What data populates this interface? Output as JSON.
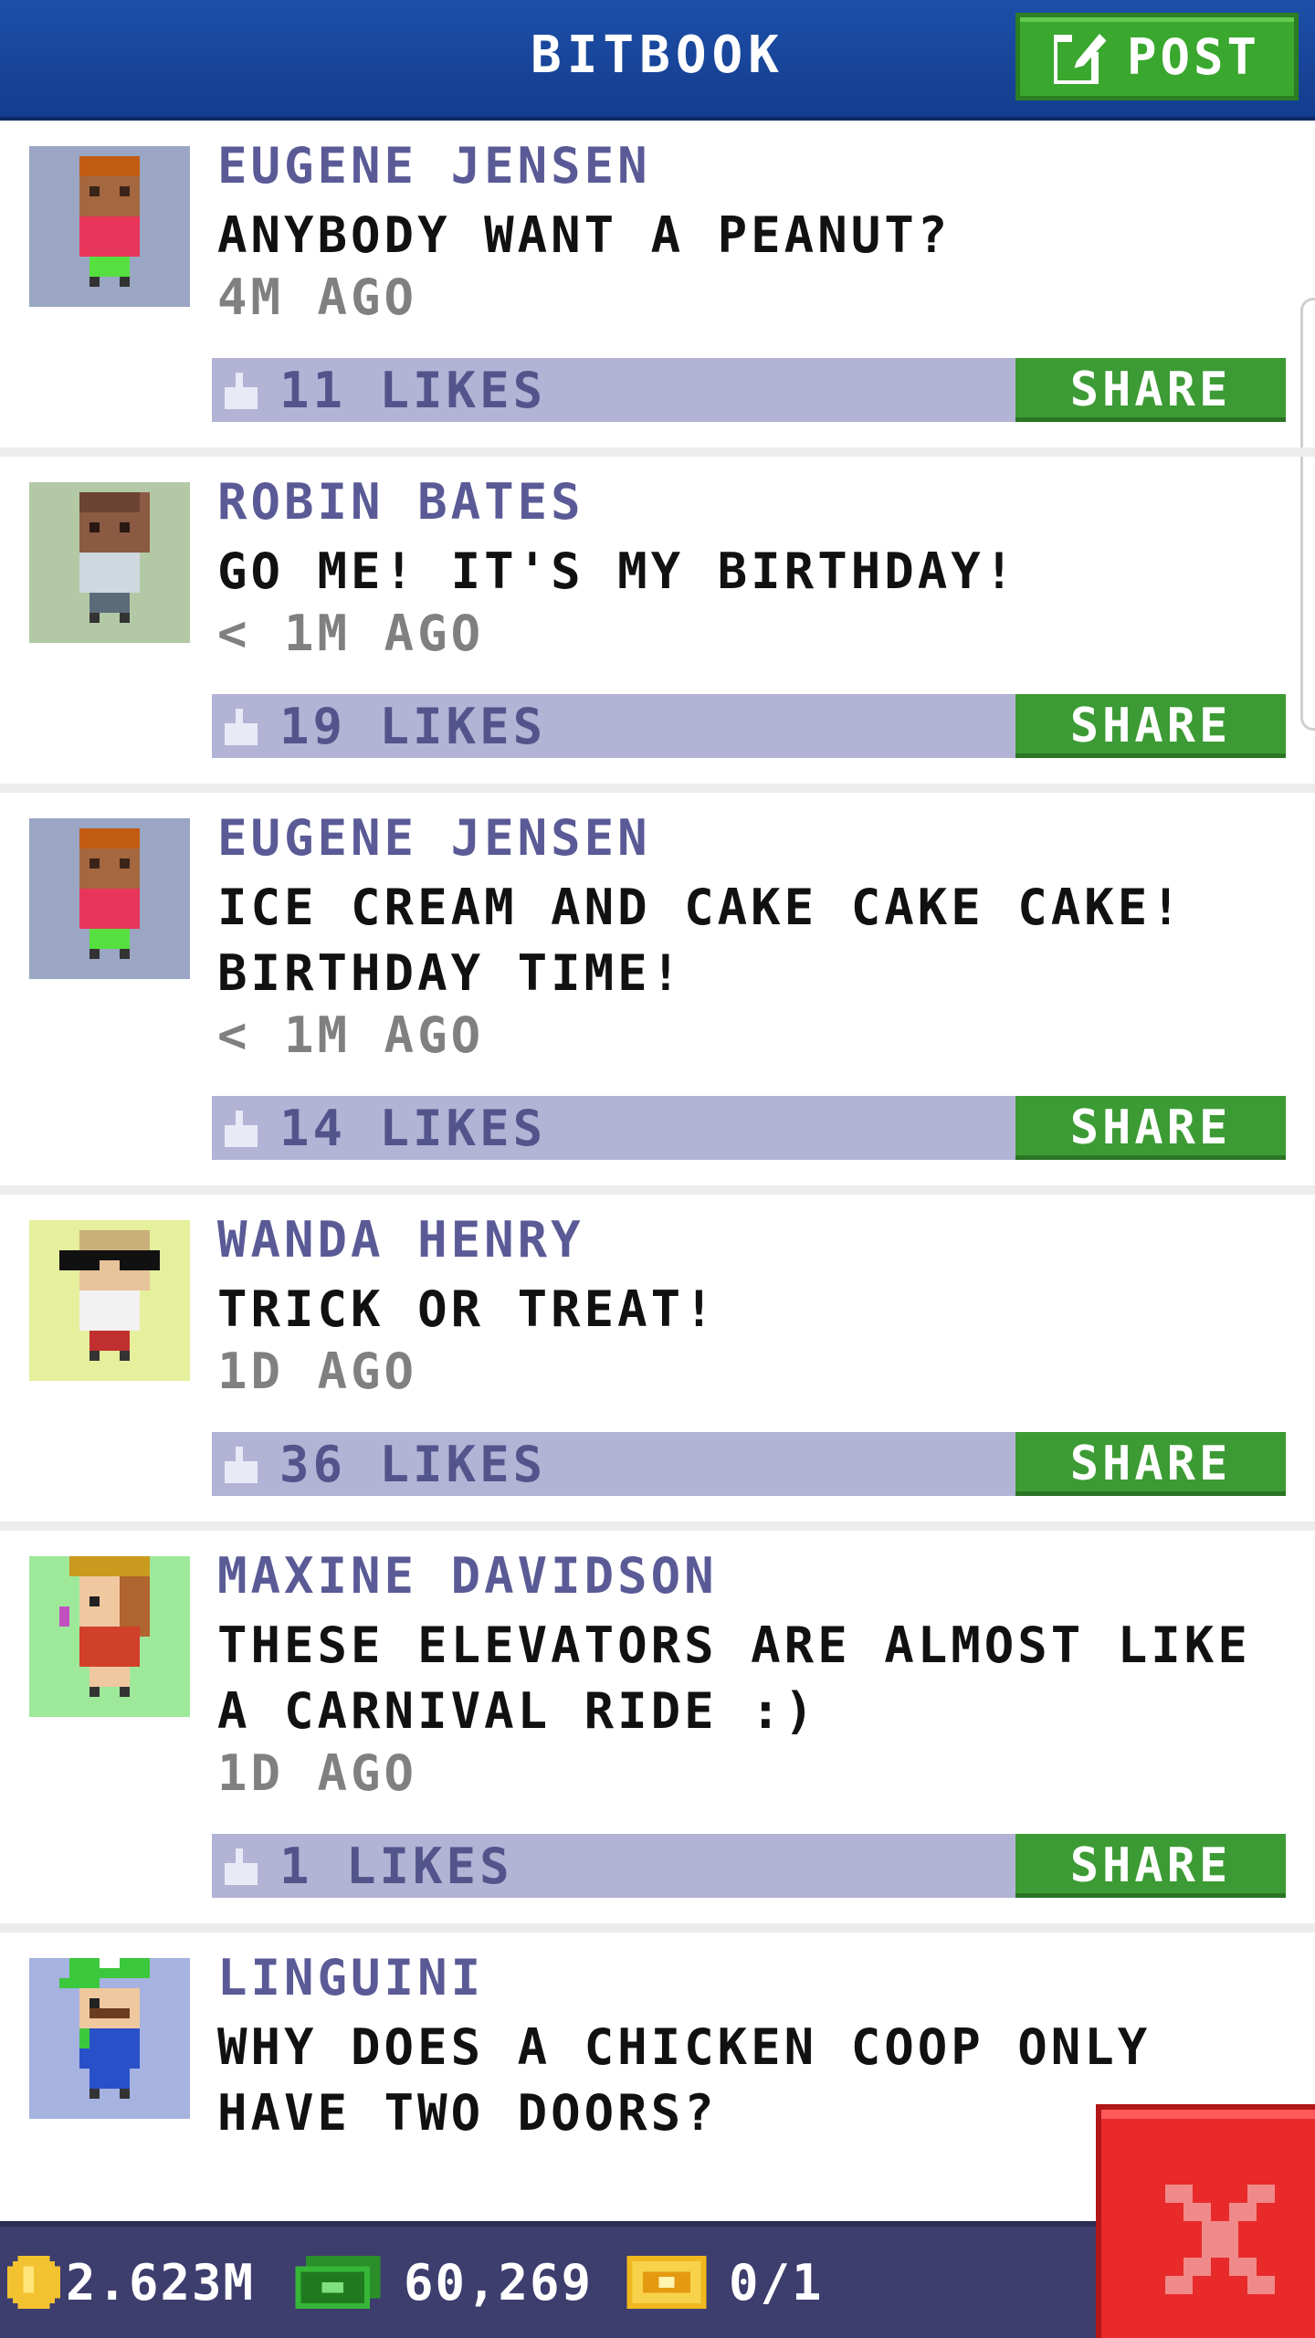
{
  "header": {
    "title": "BITBOOK",
    "post_label": "POST"
  },
  "feed": {
    "share_label": "SHARE",
    "posts": [
      {
        "author": "EUGENE JENSEN",
        "message": "ANYBODY WANT A PEANUT?",
        "time": "4M AGO",
        "likes": "11 LIKES",
        "avatar_bg": "#9aa6c4"
      },
      {
        "author": "ROBIN BATES",
        "message": "GO ME! IT'S MY BIRTHDAY!",
        "time": "< 1M AGO",
        "likes": "19 LIKES",
        "avatar_bg": "#b3c9a6"
      },
      {
        "author": "EUGENE JENSEN",
        "message": "ICE CREAM AND CAKE CAKE CAKE! BIRTHDAY TIME!",
        "time": "< 1M AGO",
        "likes": "14 LIKES",
        "avatar_bg": "#9aa6c4"
      },
      {
        "author": "WANDA HENRY",
        "message": "TRICK OR TREAT!",
        "time": "1D AGO",
        "likes": "36 LIKES",
        "avatar_bg": "#e6ef9c"
      },
      {
        "author": "MAXINE DAVIDSON",
        "message": "THESE ELEVATORS ARE ALMOST LIKE A CARNIVAL RIDE :)",
        "time": "1D AGO",
        "likes": "1 LIKES",
        "avatar_bg": "#9ee89a"
      },
      {
        "author": "LINGUINI",
        "message": "WHY DOES A CHICKEN COOP ONLY HAVE TWO DOORS?",
        "avatar_bg": "#a6b2e0"
      }
    ]
  },
  "status_bar": {
    "coins": "2.623M",
    "bux": "60,269",
    "tickets": "0/1"
  },
  "colors": {
    "header": "#1a4aa0",
    "likes_bar": "#b3b3d6",
    "share": "#3c9b34",
    "close": "#e82a2a"
  }
}
